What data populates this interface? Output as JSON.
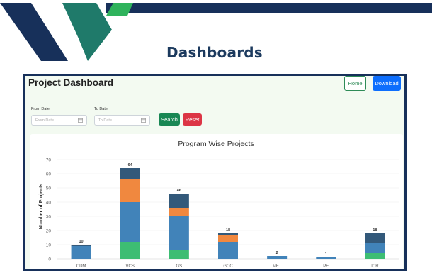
{
  "slide": {
    "title": "Dashboards"
  },
  "colors": {
    "navy": "#17305a",
    "teal": "#1f7a6a",
    "green": "#2fb35c"
  },
  "dashboard": {
    "title": "Project Dashboard",
    "home_label": "Home",
    "download_label": "Download"
  },
  "filters": {
    "from_label": "From Date",
    "from_placeholder": "From Date",
    "to_label": "To Date",
    "to_placeholder": "To Date",
    "search_label": "Search",
    "reset_label": "Reset"
  },
  "chart_data": {
    "type": "bar",
    "stacked": true,
    "title": "Program Wise Projects",
    "xlabel": "",
    "ylabel": "Number of Projects",
    "ylim": [
      0,
      70
    ],
    "yticks": [
      0,
      10,
      20,
      30,
      40,
      50,
      60,
      70
    ],
    "grid": true,
    "categories": [
      "CDM",
      "VCS",
      "GS",
      "GCC",
      "MET",
      "PE",
      "ICR"
    ],
    "totals": [
      10,
      64,
      46,
      18,
      2,
      1,
      18
    ],
    "series": [
      {
        "color": "#3dbd73",
        "values": [
          0,
          12,
          6,
          0,
          0,
          0,
          4
        ]
      },
      {
        "color": "#4183b9",
        "values": [
          9,
          28,
          24,
          12,
          2,
          1,
          7
        ]
      },
      {
        "color": "#f0883f",
        "values": [
          0,
          16,
          6,
          5,
          0,
          0,
          0
        ]
      },
      {
        "color": "#33597a",
        "values": [
          1,
          8,
          10,
          1,
          0,
          0,
          7
        ]
      }
    ]
  }
}
